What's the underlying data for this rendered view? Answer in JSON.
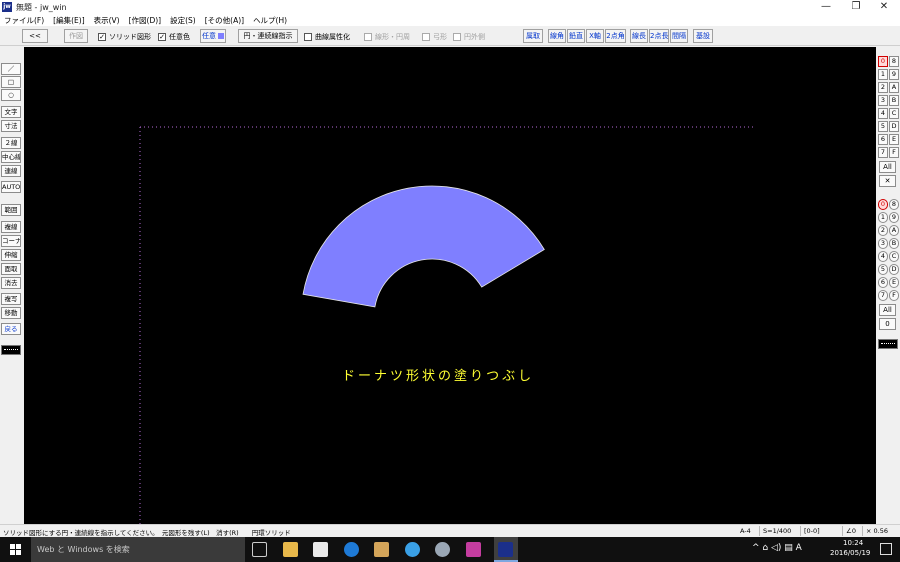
{
  "window": {
    "title": "無題 - jw_win",
    "app_icon_text": "jw",
    "min": "—",
    "restore": "❐",
    "close": "✕"
  },
  "menu": [
    "ファイル(F)",
    "[編集(E)]",
    "表示(V)",
    "[作図(D)]",
    "設定(S)",
    "[その他(A)]",
    "ヘルプ(H)"
  ],
  "toolbar": {
    "back": "<<",
    "draw": "作図",
    "solid": "ソリッド図形",
    "solid_checked": "✓",
    "any_color": "任意色",
    "any_color_checked": "✓",
    "any_btn": "任意",
    "mode_btn": "円・連続線指示",
    "curve_attr": "曲線属性化",
    "line_arc": "線形・円周",
    "arc_shape": "弓形",
    "arc_outer": "円外側",
    "right_buttons": [
      "属取",
      "線角",
      "鉛直",
      "X軸",
      "2点角",
      "線長",
      "2点長",
      "間隔",
      "基設"
    ]
  },
  "left_palette": [
    "／",
    "□",
    "○",
    "文字",
    "寸法",
    "２線",
    "中心線",
    "連線",
    "AUTO",
    "範囲",
    "複線",
    "コーナー",
    "伸縮",
    "面取",
    "消去",
    "複写",
    "移動",
    "戻る"
  ],
  "right_palette": {
    "layer_rows": [
      [
        "0",
        "8"
      ],
      [
        "1",
        "9"
      ],
      [
        "2",
        "A"
      ],
      [
        "3",
        "B"
      ],
      [
        "4",
        "C"
      ],
      [
        "5",
        "D"
      ],
      [
        "6",
        "E"
      ],
      [
        "7",
        "F"
      ]
    ],
    "all": "All",
    "cross": "✕",
    "group_rows": [
      [
        "0",
        "8"
      ],
      [
        "1",
        "9"
      ],
      [
        "2",
        "A"
      ],
      [
        "3",
        "B"
      ],
      [
        "4",
        "C"
      ],
      [
        "5",
        "D"
      ],
      [
        "6",
        "E"
      ],
      [
        "7",
        "F"
      ]
    ],
    "all2": "All",
    "zero": "0"
  },
  "canvas": {
    "caption": "ドーナツ形状の塗りつぶし",
    "fill_color": "#7f7fff",
    "caption_color": "#ffff33",
    "background": "#000000"
  },
  "status": {
    "message": "ソリッド図形にする円・連続線を指示してください。　元図形を残す(L)　消す(R)　　円環ソリッド",
    "paper": "A-4",
    "scale": "S=1/400",
    "layer": "[0-0]",
    "angle": "∠0",
    "zoom": "× 0.56"
  },
  "taskbar": {
    "search": "Web と Windows を検索",
    "tray": "^ ⌂ ◁) ▤  A",
    "time": "10:24",
    "date": "2016/05/19"
  }
}
